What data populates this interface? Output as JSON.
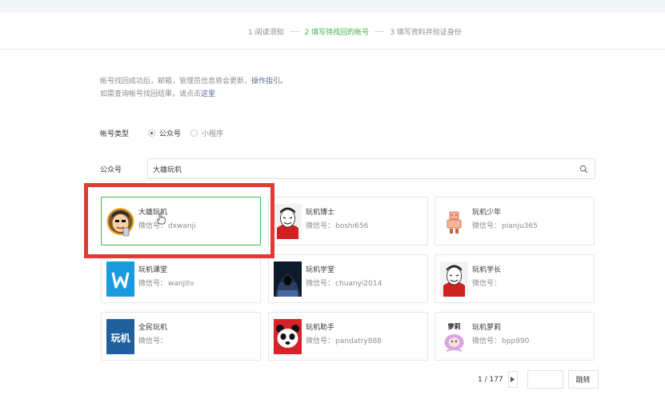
{
  "steps": [
    {
      "label": "1 阅读须知",
      "active": false
    },
    {
      "label": "2 填写待找回的帐号",
      "active": true
    },
    {
      "label": "3 填写资料并验证身份",
      "active": false
    }
  ],
  "notice": {
    "line1_text": "帐号找回成功后，邮箱，管理员信息将会更新，",
    "line1_link": "操作指引。",
    "line2_text": "如需查询帐号找回结果，请点击",
    "line2_link": "这里"
  },
  "account_type": {
    "label": "帐号类型",
    "options": [
      {
        "label": "公众号",
        "checked": true
      },
      {
        "label": "小程序",
        "checked": false
      }
    ]
  },
  "search": {
    "label": "公众号",
    "value": "大雄玩机"
  },
  "wechat_prefix": "微信号：",
  "results": [
    {
      "name": "大雄玩机",
      "wechat_id": "dxwanji",
      "avatar": "cartoon-boy-avatar",
      "selected": true
    },
    {
      "name": "玩机博士",
      "wechat_id": "boshi656",
      "avatar": "mask-avatar",
      "selected": false
    },
    {
      "name": "玩机少年",
      "wechat_id": "pianju365",
      "avatar": "robot-avatar",
      "selected": false
    },
    {
      "name": "玩机课堂",
      "wechat_id": "wanjitv",
      "avatar": "w-logo-avatar",
      "selected": false
    },
    {
      "name": "玩机学堂",
      "wechat_id": "chuanyi2014",
      "avatar": "hacker-avatar",
      "selected": false
    },
    {
      "name": "玩机学长",
      "wechat_id": "",
      "avatar": "mask-avatar",
      "selected": false
    },
    {
      "name": "全民玩机",
      "wechat_id": "",
      "avatar": "text-logo-avatar",
      "selected": false
    },
    {
      "name": "玩机助手",
      "wechat_id": "pandatry888",
      "avatar": "panda-avatar",
      "selected": false
    },
    {
      "name": "玩机萝莉",
      "wechat_id": "bpp990",
      "avatar": "girl-avatar",
      "selected": false
    }
  ],
  "text_logo": "玩机",
  "girl_logo_text": "萝莉",
  "pagination": {
    "current": "1",
    "total": "177",
    "display": "1 / 177",
    "go_label": "跳转"
  },
  "colors": {
    "accent": "#44b549",
    "link": "#576b95",
    "highlight": "#e53935"
  }
}
